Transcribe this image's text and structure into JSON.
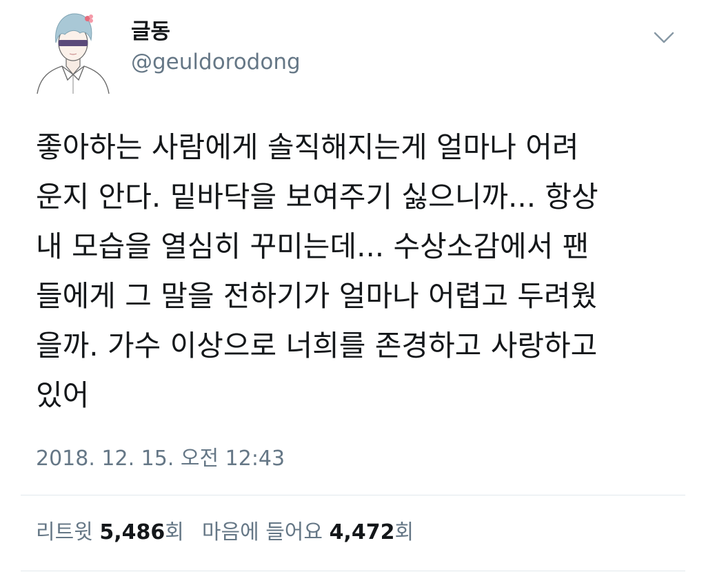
{
  "author": {
    "display_name": "글동",
    "handle": "@geuldorodong",
    "avatar_icon": "illustrated-avatar-icon"
  },
  "menu_icon": "chevron-down-icon",
  "tweet": {
    "lines": [
      "좋아하는 사람에게 솔직해지는게 얼마나 어려",
      "운지 안다. 밑바닥을 보여주기 싫으니까... 항상",
      "내 모습을 열심히 꾸미는데... 수상소감에서 팬",
      "들에게 그 말을 전하기가 얼마나 어렵고 두려웠",
      "을까. 가수 이상으로 너희를 존경하고 사랑하고",
      "있어"
    ],
    "timestamp": "2018. 12. 15. 오전 12:43"
  },
  "stats": {
    "retweets_label": "리트윗",
    "retweets_count": "5,486",
    "retweets_suffix": "회",
    "likes_label": "마음에 들어요",
    "likes_count": "4,472",
    "likes_suffix": "회"
  },
  "colors": {
    "text_primary": "#14171a",
    "text_secondary": "#657786",
    "divider": "#e1e8ed",
    "hair": "#a9c8d6"
  }
}
